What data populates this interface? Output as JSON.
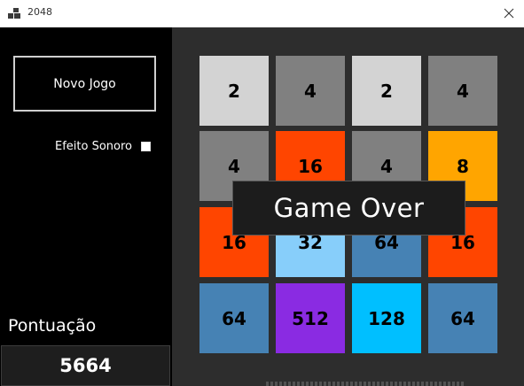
{
  "window": {
    "title": "2048",
    "close_icon": "close-icon",
    "app_icon": "tiles-app-icon"
  },
  "sidebar": {
    "new_game_label": "Novo Jogo",
    "sound_label": "Efeito Sonoro",
    "sound_enabled": false,
    "score_label": "Pontuação",
    "score_value": "5664"
  },
  "board": {
    "rows": [
      [
        {
          "value": "2",
          "color": "#d3d3d3"
        },
        {
          "value": "4",
          "color": "#808080"
        },
        {
          "value": "2",
          "color": "#d3d3d3"
        },
        {
          "value": "4",
          "color": "#808080"
        }
      ],
      [
        {
          "value": "4",
          "color": "#808080"
        },
        {
          "value": "16",
          "color": "#ff4500"
        },
        {
          "value": "4",
          "color": "#808080"
        },
        {
          "value": "8",
          "color": "#ffa500"
        }
      ],
      [
        {
          "value": "16",
          "color": "#ff4500"
        },
        {
          "value": "32",
          "color": "#87cefa"
        },
        {
          "value": "64",
          "color": "#4682b4"
        },
        {
          "value": "16",
          "color": "#ff4500"
        }
      ],
      [
        {
          "value": "64",
          "color": "#4682b4"
        },
        {
          "value": "512",
          "color": "#8a2be2"
        },
        {
          "value": "128",
          "color": "#00bfff"
        },
        {
          "value": "64",
          "color": "#4682b4"
        }
      ]
    ]
  },
  "overlay": {
    "message": "Game Over"
  },
  "colors": {
    "sidebar_bg": "#000000",
    "board_bg": "#2d2d2d",
    "overlay_bg": "#1c1c1c"
  }
}
